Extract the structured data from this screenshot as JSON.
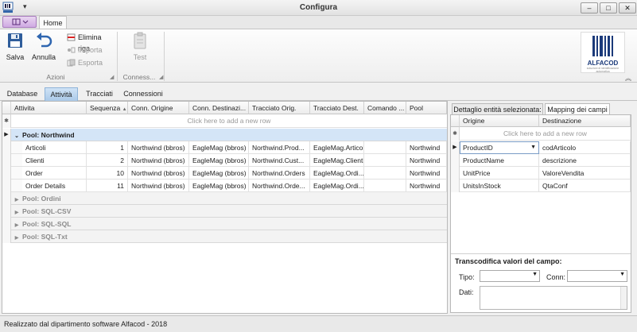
{
  "window": {
    "title": "Configura",
    "quick_access": "▾",
    "app_icon_label": "ALFACOD",
    "controls": {
      "minimize": "–",
      "restore": "□",
      "close": "✕"
    }
  },
  "ribbon": {
    "tabs": [
      {
        "label": "Home"
      }
    ],
    "groups": {
      "azioni": {
        "label": "Azioni",
        "buttons": {
          "save": "Salva",
          "undo": "Annulla"
        },
        "small": {
          "delete_row": "Elimina riga",
          "import": "Importa",
          "export": "Esporta"
        }
      },
      "connessioni": {
        "label": "Conness...",
        "test": "Test"
      }
    },
    "logo": {
      "text": "ALFACOD",
      "tagline": "soluzioni di identificazione automatica"
    }
  },
  "subtabs": [
    {
      "label": "Database"
    },
    {
      "label": "Attività"
    },
    {
      "label": "Tracciati"
    },
    {
      "label": "Connessioni"
    }
  ],
  "grid": {
    "columns": [
      "Attivita",
      "Sequenza",
      "Conn. Origine",
      "Conn. Destinazi...",
      "Tracciato Orig.",
      "Tracciato Dest.",
      "Comando ...",
      "Pool"
    ],
    "sort_indicator": "▲",
    "add_row_hint": "Click here to add a new row",
    "groups": [
      {
        "label": "Pool: Northwind",
        "expanded": true
      },
      {
        "label": "Pool: Ordini",
        "expanded": false
      },
      {
        "label": "Pool: SQL-CSV",
        "expanded": false
      },
      {
        "label": "Pool: SQL-SQL",
        "expanded": false
      },
      {
        "label": "Pool: SQL-Txt",
        "expanded": false
      }
    ],
    "rows": [
      {
        "attivita": "Articoli",
        "sequenza": "1",
        "conn_origine": "Northwind (bbros)",
        "conn_dest": "EagleMag (bbros)",
        "tracc_orig": "Northwind.Prod...",
        "tracc_dest": "EagleMag.Articoli",
        "comando": "",
        "pool": "Northwind"
      },
      {
        "attivita": "Clienti",
        "sequenza": "2",
        "conn_origine": "Northwind (bbros)",
        "conn_dest": "EagleMag (bbros)",
        "tracc_orig": "Northwind.Cust...",
        "tracc_dest": "EagleMag.Clienti",
        "comando": "",
        "pool": "Northwind"
      },
      {
        "attivita": "Order",
        "sequenza": "10",
        "conn_origine": "Northwind (bbros)",
        "conn_dest": "EagleMag (bbros)",
        "tracc_orig": "Northwind.Orders",
        "tracc_dest": "EagleMag.Ordi...",
        "comando": "",
        "pool": "Northwind"
      },
      {
        "attivita": "Order Details",
        "sequenza": "11",
        "conn_origine": "Northwind (bbros)",
        "conn_dest": "EagleMag (bbros)",
        "tracc_orig": "Northwind.Orde...",
        "tracc_dest": "EagleMag.Ordi...",
        "comando": "",
        "pool": "Northwind"
      }
    ]
  },
  "right_panel": {
    "tabs": [
      {
        "label": "Dettaglio entità selezionata:"
      },
      {
        "label": "Mapping dei campi"
      }
    ],
    "columns": [
      "Origine",
      "Destinazione"
    ],
    "add_row_hint": "Click here to add a new row",
    "rows": [
      {
        "origine": "ProductID",
        "destinazione": "codArticolo"
      },
      {
        "origine": "ProductName",
        "destinazione": "descrizione"
      },
      {
        "origine": "UnitPrice",
        "destinazione": "ValoreVendita"
      },
      {
        "origine": "UnitsInStock",
        "destinazione": "QtaConf"
      }
    ],
    "transcodifica": {
      "title": "Transcodifica valori del campo:",
      "tipo_label": "Tipo:",
      "conn_label": "Conn:",
      "dati_label": "Dati:",
      "tipo_value": "",
      "conn_value": ""
    }
  },
  "status": {
    "text": "Realizzato dal dipartimento software Alfacod - 2018"
  }
}
